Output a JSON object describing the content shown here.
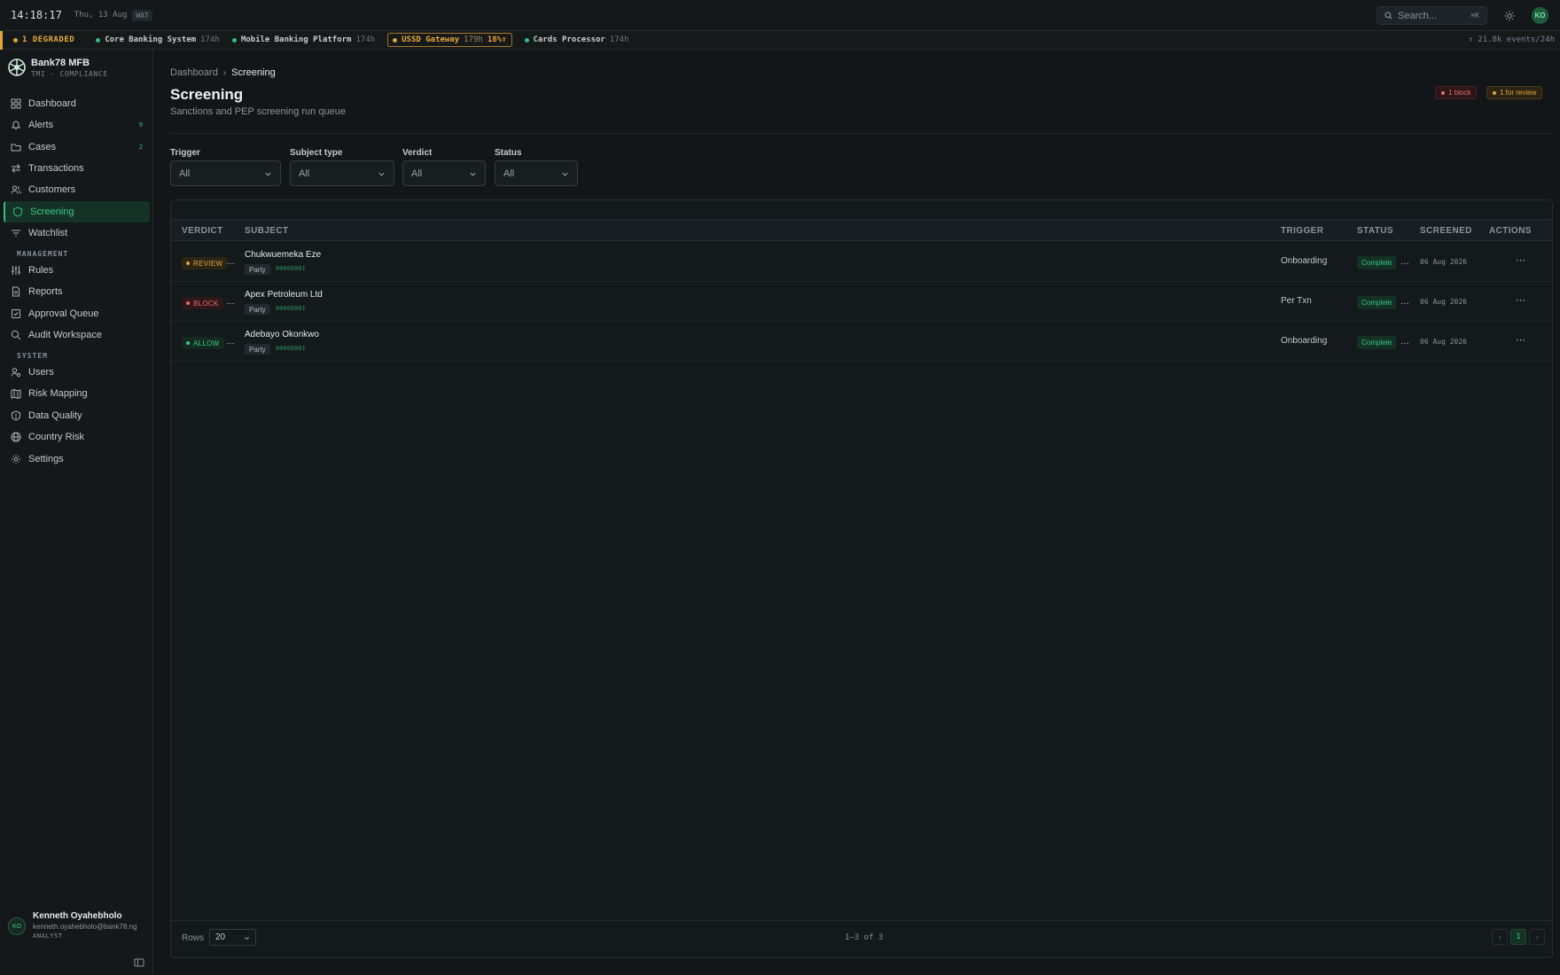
{
  "topbar": {
    "time": "14:18:17",
    "date": "Thu, 13 Aug",
    "tz": "WAT",
    "search_placeholder": "Search...",
    "search_shortcut": "⌘K",
    "avatar_initials": "KO"
  },
  "status_strip": {
    "degraded": "1 DEGRADED",
    "services": [
      {
        "name": "Core Banking System",
        "uptime": "174h"
      },
      {
        "name": "Mobile Banking Platform",
        "uptime": "174h"
      },
      {
        "name": "USSD Gateway",
        "uptime": "179h",
        "extra": "18%↑"
      },
      {
        "name": "Cards Processor",
        "uptime": "174h"
      }
    ],
    "events": "↑ 21.8k events/24h"
  },
  "brand": {
    "name": "Bank78 MFB",
    "sub": "TMI · COMPLIANCE"
  },
  "nav": {
    "items": [
      {
        "label": "Dashboard"
      },
      {
        "label": "Alerts",
        "count": "9"
      },
      {
        "label": "Cases",
        "count": "2"
      },
      {
        "label": "Transactions"
      },
      {
        "label": "Customers"
      },
      {
        "label": "Screening"
      },
      {
        "label": "Watchlist"
      }
    ],
    "section_management": "MANAGEMENT",
    "management": [
      {
        "label": "Rules"
      },
      {
        "label": "Reports"
      },
      {
        "label": "Approval Queue"
      },
      {
        "label": "Audit Workspace"
      }
    ],
    "section_system": "SYSTEM",
    "system": [
      {
        "label": "Users"
      },
      {
        "label": "Risk Mapping"
      },
      {
        "label": "Data Quality"
      },
      {
        "label": "Country Risk"
      },
      {
        "label": "Settings"
      }
    ]
  },
  "user": {
    "initials": "KO",
    "name": "Kenneth Oyahebholo",
    "email": "kenneth.oyahebholo@bank78.ng",
    "role": "ANALYST"
  },
  "page": {
    "breadcrumb_parent": "Dashboard",
    "breadcrumb_current": "Screening",
    "title": "Screening",
    "subtitle": "Sanctions and PEP screening run queue",
    "pill_block": "1 block",
    "pill_review": "1 for review"
  },
  "filters": [
    {
      "label": "Trigger",
      "value": "All"
    },
    {
      "label": "Subject type",
      "value": "All"
    },
    {
      "label": "Verdict",
      "value": "All"
    },
    {
      "label": "Status",
      "value": "All"
    }
  ],
  "table": {
    "columns": [
      "VERDICT",
      "SUBJECT",
      "TRIGGER",
      "STATUS",
      "SCREENED",
      "ACTIONS"
    ],
    "rows": [
      {
        "verdict": "REVIEW",
        "subject": "Chukwuemeka Eze",
        "type": "Party",
        "id": "00000001",
        "trigger": "Onboarding",
        "status": "Complete",
        "screened": "06 Aug 2026"
      },
      {
        "verdict": "BLOCK",
        "subject": "Apex Petroleum Ltd",
        "type": "Party",
        "id": "00000001",
        "trigger": "Per Txn",
        "status": "Complete",
        "screened": "06 Aug 2026"
      },
      {
        "verdict": "ALLOW",
        "subject": "Adebayo Okonkwo",
        "type": "Party",
        "id": "00000001",
        "trigger": "Onboarding",
        "status": "Complete",
        "screened": "06 Aug 2026"
      }
    ],
    "rows_label": "Rows",
    "rows_value": "20",
    "range": "1–3 of 3",
    "page": "1"
  },
  "colors": {
    "accent": "#2fbf80",
    "warn": "#e0a43a",
    "danger": "#e56d6d",
    "bg": "#121619"
  }
}
